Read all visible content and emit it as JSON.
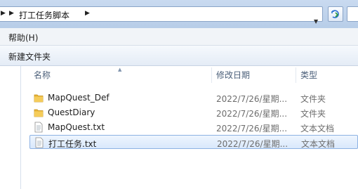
{
  "address": {
    "breadcrumb": "打工任务脚本",
    "colors": {
      "bar": "#c9daf0"
    }
  },
  "menu": {
    "help_label": "帮助(H)"
  },
  "toolbar": {
    "new_folder_label": "新建文件夹"
  },
  "columns": {
    "name": "名称",
    "date": "修改日期",
    "type": "类型"
  },
  "files": [
    {
      "name": "MapQuest_Def",
      "date": "2022/7/26/星期...",
      "type": "文件夹",
      "icon": "folder-icon"
    },
    {
      "name": "QuestDiary",
      "date": "2022/7/26/星期...",
      "type": "文件夹",
      "icon": "folder-icon"
    },
    {
      "name": "MapQuest.txt",
      "date": "2022/7/26/星期...",
      "type": "文本文档",
      "icon": "text-file-icon"
    },
    {
      "name": "打工任务.txt",
      "date": "2022/7/26/星期...",
      "type": "文本文档",
      "icon": "text-file-icon",
      "selected": true
    }
  ]
}
